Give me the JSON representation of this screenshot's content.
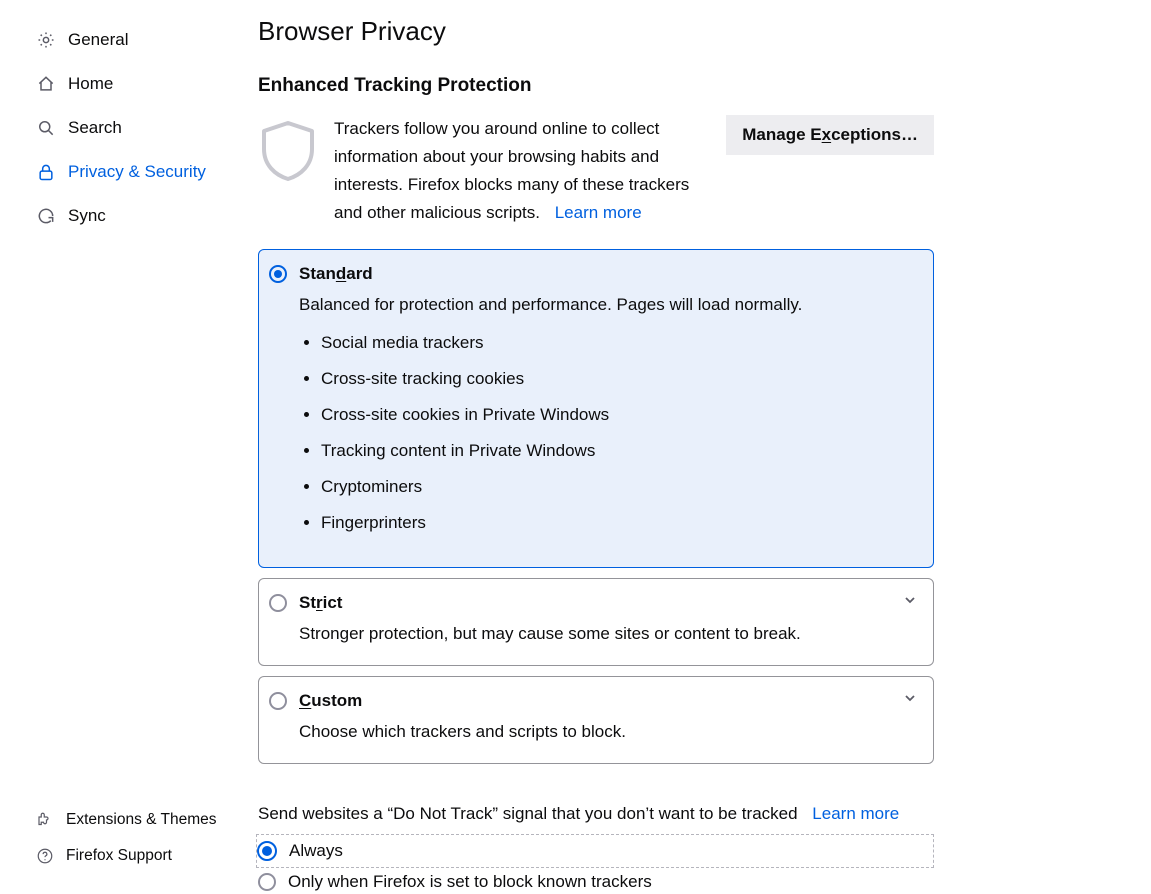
{
  "sidebar": {
    "items": [
      {
        "label": "General"
      },
      {
        "label": "Home"
      },
      {
        "label": "Search"
      },
      {
        "label": "Privacy & Security"
      },
      {
        "label": "Sync"
      }
    ],
    "footer": [
      {
        "label": "Extensions & Themes"
      },
      {
        "label": "Firefox Support"
      }
    ]
  },
  "title": "Browser Privacy",
  "etp": {
    "heading": "Enhanced Tracking Protection",
    "description": "Trackers follow you around online to collect information about your browsing habits and interests. Firefox blocks many of these trackers and other malicious scripts.",
    "learn_more": "Learn more",
    "manage_exceptions_pre": "Manage E",
    "manage_exceptions_key": "x",
    "manage_exceptions_post": "ceptions…",
    "levels": {
      "standard": {
        "title_pre": "Stan",
        "title_key": "d",
        "title_post": "ard",
        "sub": "Balanced for protection and performance. Pages will load normally.",
        "features": [
          "Social media trackers",
          "Cross-site tracking cookies",
          "Cross-site cookies in Private Windows",
          "Tracking content in Private Windows",
          "Cryptominers",
          "Fingerprinters"
        ]
      },
      "strict": {
        "title_pre": "St",
        "title_key": "r",
        "title_post": "ict",
        "sub": "Stronger protection, but may cause some sites or content to break."
      },
      "custom": {
        "title_key": "C",
        "title_post": "ustom",
        "sub": "Choose which trackers and scripts to block."
      }
    }
  },
  "dnt": {
    "text": "Send websites a “Do Not Track” signal that you don’t want to be tracked",
    "learn_more": "Learn more",
    "always": "Always",
    "only_known": "Only when Firefox is set to block known trackers"
  }
}
